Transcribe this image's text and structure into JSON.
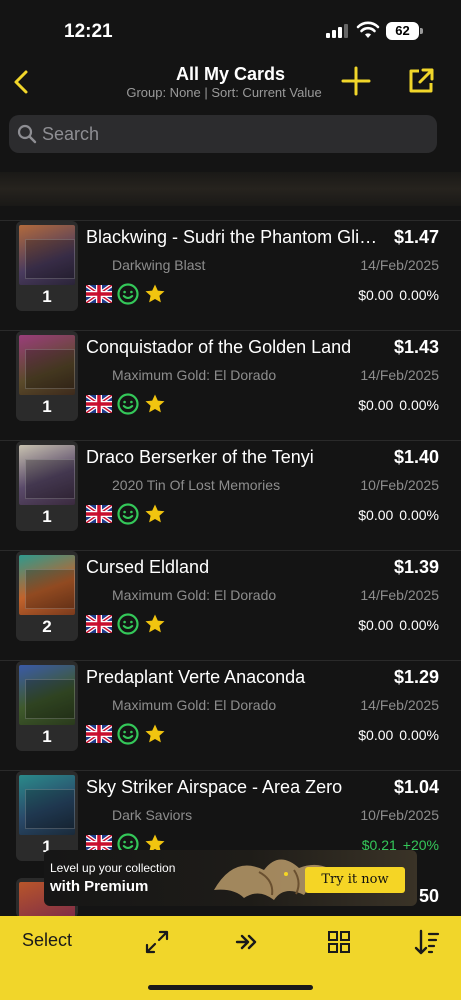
{
  "status": {
    "time": "12:21",
    "battery": "62"
  },
  "nav": {
    "title": "All My Cards",
    "subtitle": "Group: None | Sort: Current Value",
    "back_icon": "chevron-left-icon",
    "add_icon": "plus-icon",
    "share_icon": "share-icon"
  },
  "search": {
    "placeholder": "Search"
  },
  "colors": {
    "accent": "#f1d62a",
    "positive": "#34c759"
  },
  "cards": [
    {
      "name": "Blackwing - Sudri the Phantom Glimmer",
      "price": "$1.47",
      "set": "Darkwing Blast",
      "date": "14/Feb/2025",
      "qty": "1",
      "change": "$0.00",
      "change_pct": "0.00%",
      "positive": false
    },
    {
      "name": "Conquistador of the Golden Land",
      "price": "$1.43",
      "set": "Maximum Gold: El Dorado",
      "date": "14/Feb/2025",
      "qty": "1",
      "change": "$0.00",
      "change_pct": "0.00%",
      "positive": false
    },
    {
      "name": "Draco Berserker of the Tenyi",
      "price": "$1.40",
      "set": "2020 Tin Of Lost Memories",
      "date": "10/Feb/2025",
      "qty": "1",
      "change": "$0.00",
      "change_pct": "0.00%",
      "positive": false
    },
    {
      "name": "Cursed Eldland",
      "price": "$1.39",
      "set": "Maximum Gold: El Dorado",
      "date": "14/Feb/2025",
      "qty": "2",
      "change": "$0.00",
      "change_pct": "0.00%",
      "positive": false
    },
    {
      "name": "Predaplant Verte Anaconda",
      "price": "$1.29",
      "set": "Maximum Gold: El Dorado",
      "date": "14/Feb/2025",
      "qty": "1",
      "change": "$0.00",
      "change_pct": "0.00%",
      "positive": false
    },
    {
      "name": "Sky Striker Airspace - Area Zero",
      "price": "$1.04",
      "set": "Dark Saviors",
      "date": "10/Feb/2025",
      "qty": "1",
      "change": "$0.21",
      "change_pct": "+20%",
      "positive": true
    }
  ],
  "partial_card": {
    "price": "50"
  },
  "promo": {
    "line1": "Level up your collection",
    "line2": "with Premium",
    "button": "Try it now"
  },
  "toolbar": {
    "select": "Select",
    "icons": [
      "expand-icon",
      "chevrons-right-icon",
      "grid-icon",
      "sort-icon"
    ]
  }
}
